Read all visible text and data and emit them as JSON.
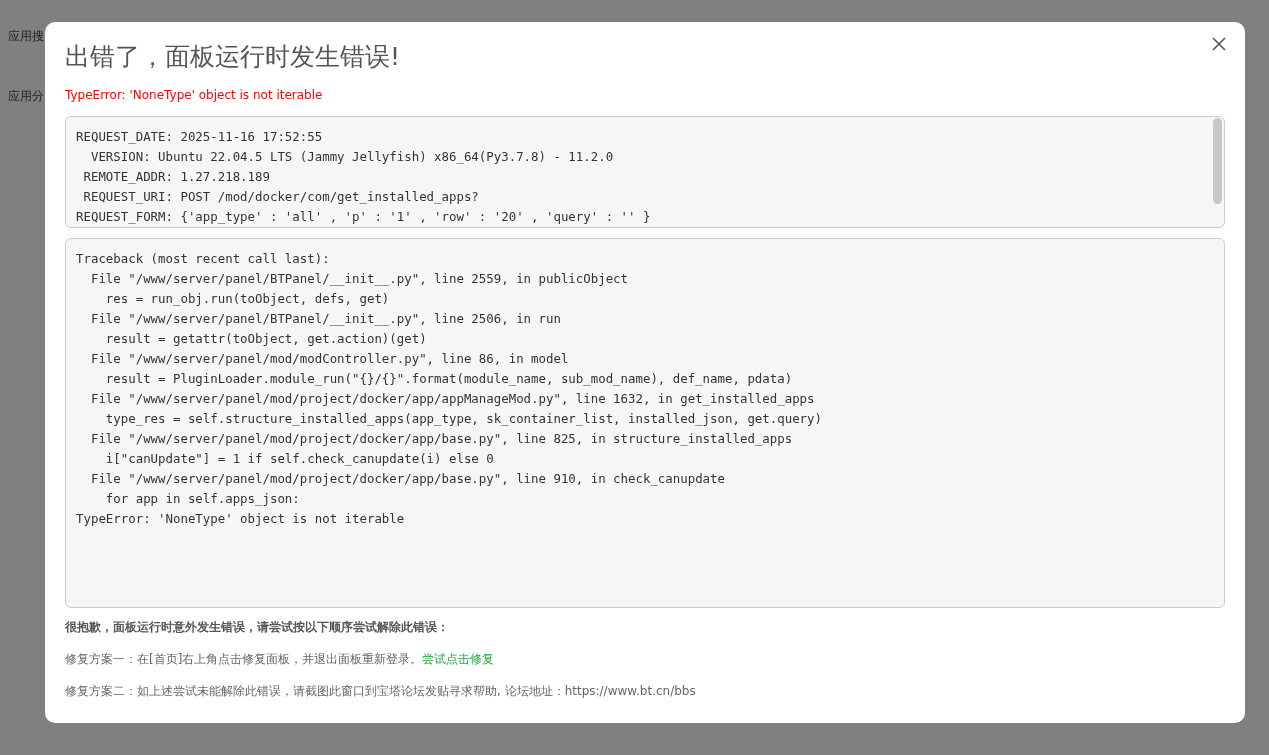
{
  "background_page": {
    "labels": [
      "应用搜",
      "应用分"
    ]
  },
  "dialog": {
    "title": "出错了，面板运行时发生错误!",
    "error_message": "TypeError: 'NoneType' object is not iterable",
    "request_info": [
      "REQUEST_DATE: 2025-11-16 17:52:55",
      "  VERSION: Ubuntu 22.04.5 LTS (Jammy Jellyfish) x86_64(Py3.7.8) - 11.2.0",
      " REMOTE_ADDR: 1.27.218.189",
      " REQUEST_URI: POST /mod/docker/com/get_installed_apps?",
      "REQUEST_FORM: {'app_type' : 'all' , 'p' : '1' , 'row' : '20' , 'query' : '' }"
    ],
    "traceback": [
      "Traceback (most recent call last):",
      "  File \"/www/server/panel/BTPanel/__init__.py\", line 2559, in publicObject",
      "    res = run_obj.run(toObject, defs, get)",
      "  File \"/www/server/panel/BTPanel/__init__.py\", line 2506, in run",
      "    result = getattr(toObject, get.action)(get)",
      "  File \"/www/server/panel/mod/modController.py\", line 86, in model",
      "    result = PluginLoader.module_run(\"{}/{}\".format(module_name, sub_mod_name), def_name, pdata)",
      "  File \"/www/server/panel/mod/project/docker/app/appManageMod.py\", line 1632, in get_installed_apps",
      "    type_res = self.structure_installed_apps(app_type, sk_container_list, installed_json, get.query)",
      "  File \"/www/server/panel/mod/project/docker/app/base.py\", line 825, in structure_installed_apps",
      "    i[\"canUpdate\"] = 1 if self.check_canupdate(i) else 0",
      "  File \"/www/server/panel/mod/project/docker/app/base.py\", line 910, in check_canupdate",
      "    for app in self.apps_json:",
      "TypeError: 'NoneType' object is not iterable"
    ],
    "help_heading": "很抱歉，面板运行时意外发生错误，请尝试按以下顺序尝试解除此错误：",
    "fix_1": {
      "text": "修复方案一：在[首页]右上角点击修复面板，并退出面板重新登录。",
      "link": "尝试点击修复"
    },
    "fix_2": "修复方案二：如上述尝试未能解除此错误，请截图此窗口到宝塔论坛发贴寻求帮助, 论坛地址：https://www.bt.cn/bbs"
  }
}
